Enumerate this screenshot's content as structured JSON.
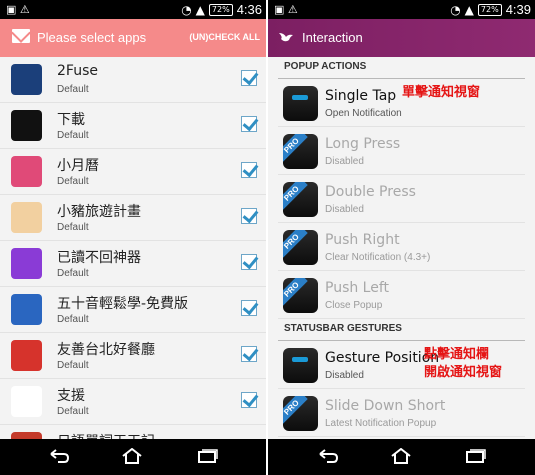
{
  "left": {
    "status": {
      "time": "4:36",
      "battery": "72%"
    },
    "appbar": {
      "title": "Please select apps",
      "action": "(UN)CHECK ALL"
    },
    "apps": [
      {
        "name": "2Fuse",
        "sub": "Default",
        "icon": "2fuse-app-icon",
        "color": "#1b3f7a"
      },
      {
        "name": "下載",
        "sub": "Default",
        "icon": "download-app-icon",
        "color": "#111111"
      },
      {
        "name": "小月曆",
        "sub": "Default",
        "icon": "calendar-flower-app-icon",
        "color": "#e04a78"
      },
      {
        "name": "小豬旅遊計畫",
        "sub": "Default",
        "icon": "pig-travel-app-icon",
        "color": "#f2d0a0"
      },
      {
        "name": "已讀不回神器",
        "sub": "Default",
        "icon": "chat-bubble-app-icon",
        "color": "#8a3bd6"
      },
      {
        "name": "五十音輕鬆學-免費版",
        "sub": "Default",
        "icon": "japanese-letter-app-icon",
        "color": "#2a66c0"
      },
      {
        "name": "友善台北好餐廳",
        "sub": "Default",
        "icon": "restaurant-app-icon",
        "color": "#d6332c"
      },
      {
        "name": "支援",
        "sub": "Default",
        "icon": "xperia-care-app-icon",
        "color": "#ffffff"
      },
      {
        "name": "日語單詞天天記",
        "sub": "",
        "icon": "japanese-words-app-icon",
        "color": "#c43a2a"
      }
    ]
  },
  "right": {
    "status": {
      "time": "4:39",
      "battery": "72%"
    },
    "appbar": {
      "title": "Interaction"
    },
    "sections": {
      "popup": "POPUP ACTIONS",
      "statusbar": "STATUSBAR GESTURES"
    },
    "popup_items": [
      {
        "title": "Single Tap",
        "sub": "Open Notification",
        "pro": false,
        "disabled": false
      },
      {
        "title": "Long Press",
        "sub": "Disabled",
        "pro": true,
        "disabled": true
      },
      {
        "title": "Double Press",
        "sub": "Disabled",
        "pro": true,
        "disabled": true
      },
      {
        "title": "Push Right",
        "sub": "Clear Notification (4.3+)",
        "pro": true,
        "disabled": true
      },
      {
        "title": "Push Left",
        "sub": "Close Popup",
        "pro": true,
        "disabled": true
      }
    ],
    "gesture_items": [
      {
        "title": "Gesture Position",
        "sub": "Disabled",
        "pro": false,
        "disabled": false
      },
      {
        "title": "Slide Down Short",
        "sub": "Latest Notification Popup",
        "pro": true,
        "disabled": true
      }
    ],
    "pro_badge": "PRO",
    "annotations": {
      "single_tap": "單擊通知視窗",
      "gesture_line1": "點擊通知欄",
      "gesture_line2": "開啟通知視窗"
    }
  },
  "colors": {
    "left_appbar": "#f58a8a",
    "right_appbar": "#8a2770",
    "checkbox_check": "#2f8fc3",
    "annotation": "#e51515",
    "pro_ribbon": "#2b7fc7"
  }
}
